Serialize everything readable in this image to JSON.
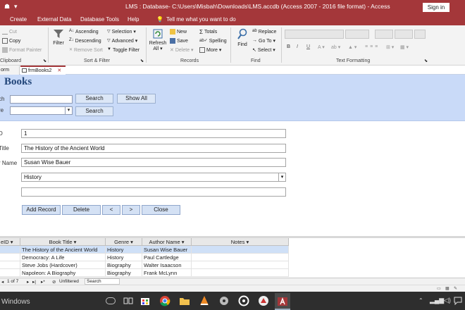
{
  "app": {
    "title": "LMS : Database- C:\\Users\\Misbah\\Downloads\\LMS.accdb (Access 2007 - 2016 file format)  -  Access",
    "sign_in": "Sign in",
    "accent": "#a4373a"
  },
  "ribbon_tabs": [
    "Create",
    "External Data",
    "Database Tools",
    "Help"
  ],
  "tell_me": "Tell me what you want to do",
  "ribbon": {
    "clipboard": {
      "cut": "Cut",
      "copy": "Copy",
      "format_painter": "Format Painter",
      "label": "Clipboard"
    },
    "sort_filter": {
      "filter": "Filter",
      "ascending": "Ascending",
      "descending": "Descending",
      "remove_sort": "Remove Sort",
      "selection": "Selection",
      "advanced": "Advanced",
      "toggle_filter": "Toggle Filter",
      "label": "Sort & Filter"
    },
    "records": {
      "refresh": "Refresh",
      "refresh_all": "All",
      "new": "New",
      "save": "Save",
      "delete": "Delete",
      "totals": "Totals",
      "spelling": "Spelling",
      "more": "More",
      "label": "Records"
    },
    "find": {
      "find": "Find",
      "replace": "Replace",
      "goto": "Go To",
      "select": "Select",
      "label": "Find"
    },
    "text_formatting": {
      "bold": "B",
      "italic": "I",
      "underline": "U",
      "label": "Text Formatting"
    }
  },
  "doc_tabs": {
    "prev": "orm",
    "active": "frmBooks2"
  },
  "form": {
    "title": "Books",
    "search_label_1": "ch",
    "search_label_2": "re",
    "search_button_1": "Search",
    "show_all": "Show All",
    "search_button_2": "Search"
  },
  "detail": {
    "labels": {
      "id": "D",
      "title": "Title",
      "author": "r Name"
    },
    "id_value": "1",
    "title_value": "The History of the Ancient World",
    "author_value": "Susan Wise Bauer",
    "genre_value": "History",
    "notes_value": ""
  },
  "buttons": {
    "add": "Add Record",
    "delete": "Delete",
    "prev": "<",
    "next": ">",
    "close": "Close"
  },
  "datasheet": {
    "headers": [
      "eID",
      "Book Title",
      "Genre",
      "Author Name",
      "Notes"
    ],
    "rows": [
      {
        "title": "The History of the Ancient World",
        "genre": "History",
        "author": "Susan Wise Bauer"
      },
      {
        "title": "Democracy: A Life",
        "genre": "History",
        "author": "Paul Cartledge"
      },
      {
        "title": "Steve Jobs (Hardcover)",
        "genre": "Biography",
        "author": " Walter Isaacson"
      },
      {
        "title": "Napoleon: A Biography",
        "genre": "Biography",
        "author": "Frank McLynn"
      }
    ]
  },
  "nav": {
    "record_of": "1 of 7",
    "unfiltered": "Unfiltered",
    "search": "Search"
  },
  "taskbar": {
    "label": "Windows"
  }
}
